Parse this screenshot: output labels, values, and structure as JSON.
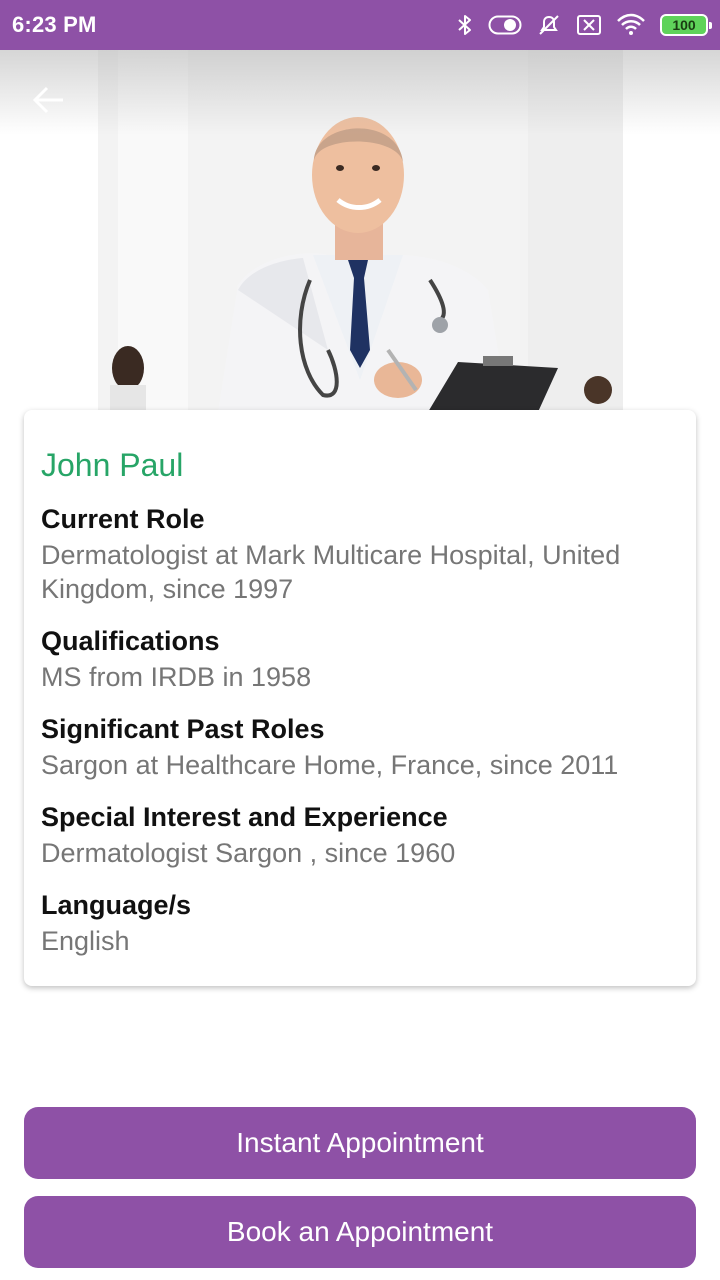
{
  "status_bar": {
    "time": "6:23 PM",
    "battery_level": "100",
    "icons": [
      "bluetooth-icon",
      "toggle-icon",
      "mute-icon",
      "sim-blocked-icon",
      "wifi-icon",
      "battery-icon"
    ]
  },
  "header": {
    "back_icon": "arrow-left-icon"
  },
  "doctor": {
    "name": "John Paul",
    "sections": [
      {
        "title": "Current Role",
        "value": "Dermatologist  at Mark Multicare Hospital, United Kingdom, since 1997"
      },
      {
        "title": "Qualifications",
        "value": "MS from IRDB in 1958"
      },
      {
        "title": "Significant Past Roles",
        "value": "Sargon at Healthcare Home, France, since 2011"
      },
      {
        "title": "Special Interest and Experience",
        "value": "Dermatologist Sargon , since 1960"
      },
      {
        "title": "Language/s",
        "value": "English"
      }
    ]
  },
  "actions": {
    "instant_label": "Instant Appointment",
    "book_label": "Book an Appointment"
  },
  "colors": {
    "primary": "#8e51a6",
    "name_green": "#27a567",
    "value_gray": "#767676"
  }
}
